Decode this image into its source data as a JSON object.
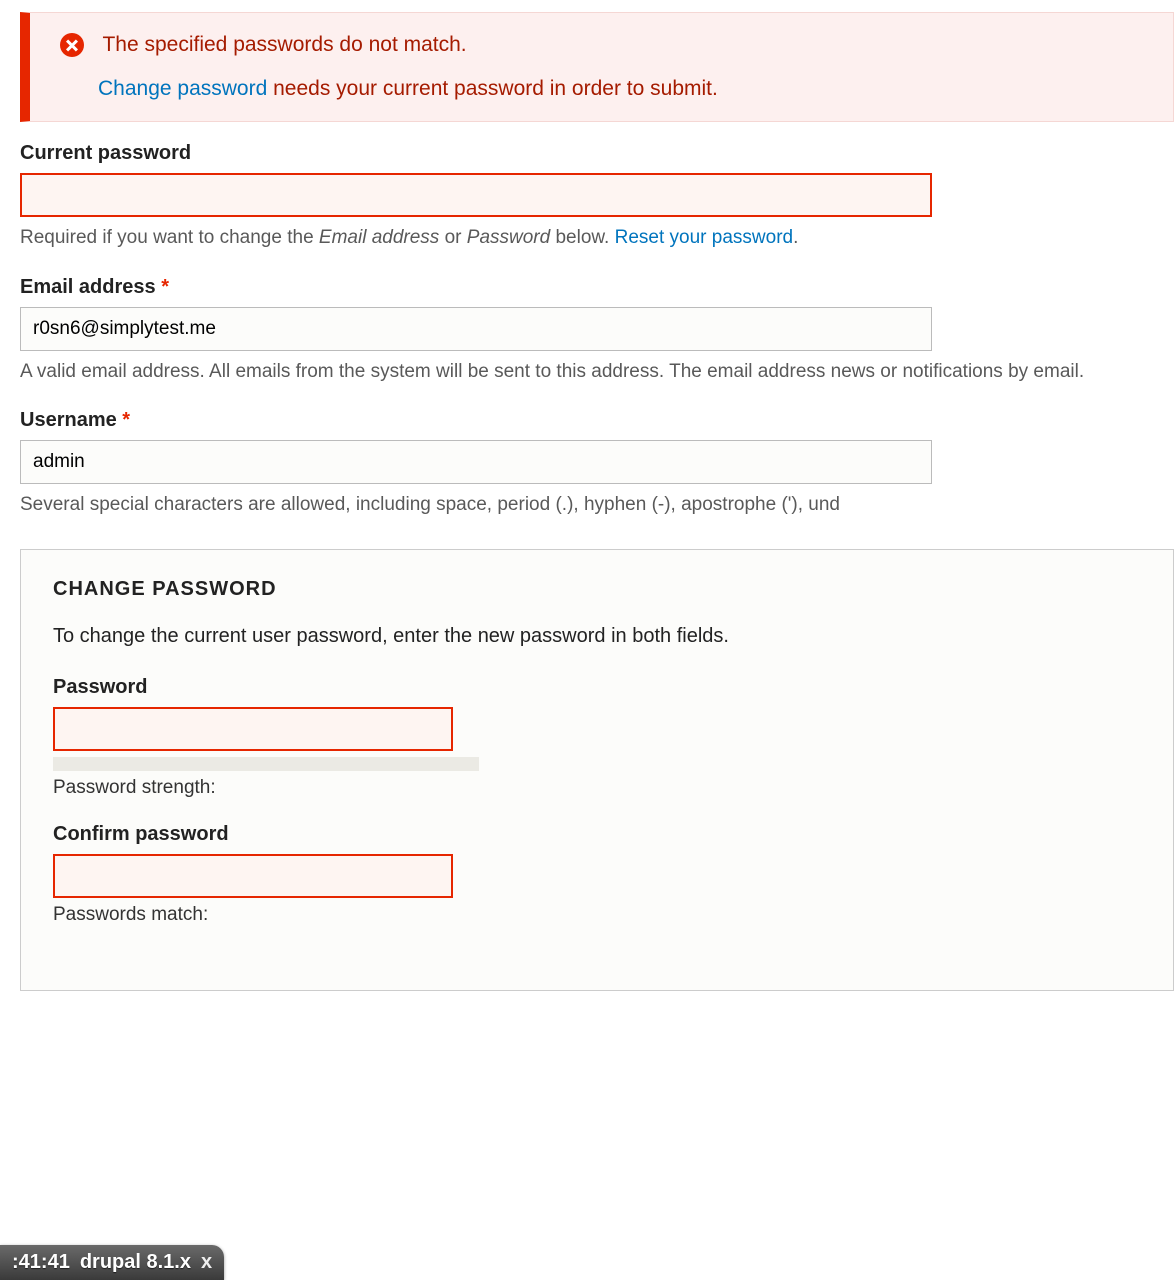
{
  "error": {
    "message": "The specified passwords do not match.",
    "link_text": "Change password",
    "after_link": " needs your current password in order to submit."
  },
  "current_password": {
    "label": "Current password",
    "value": "",
    "help_before": "Required if you want to change the ",
    "help_em1": "Email address",
    "help_mid": " or ",
    "help_em2": "Password",
    "help_after": " below. ",
    "reset_link": "Reset your password",
    "period": "."
  },
  "email": {
    "label": "Email address",
    "value": "r0sn6@simplytest.me",
    "help": "A valid email address. All emails from the system will be sent to this address. The email address news or notifications by email."
  },
  "username": {
    "label": "Username",
    "value": "admin",
    "help": "Several special characters are allowed, including space, period (.), hyphen (-), apostrophe ('), und"
  },
  "change_password": {
    "legend": "CHANGE PASSWORD",
    "desc": "To change the current user password, enter the new password in both fields.",
    "password_label": "Password",
    "password_value": "",
    "strength_label": "Password strength:",
    "confirm_label": "Confirm password",
    "confirm_value": "",
    "match_label": "Passwords match:"
  },
  "tab": {
    "time": ":41:41",
    "title": "drupal 8.1.x",
    "close": "x"
  },
  "required_marker": "*"
}
